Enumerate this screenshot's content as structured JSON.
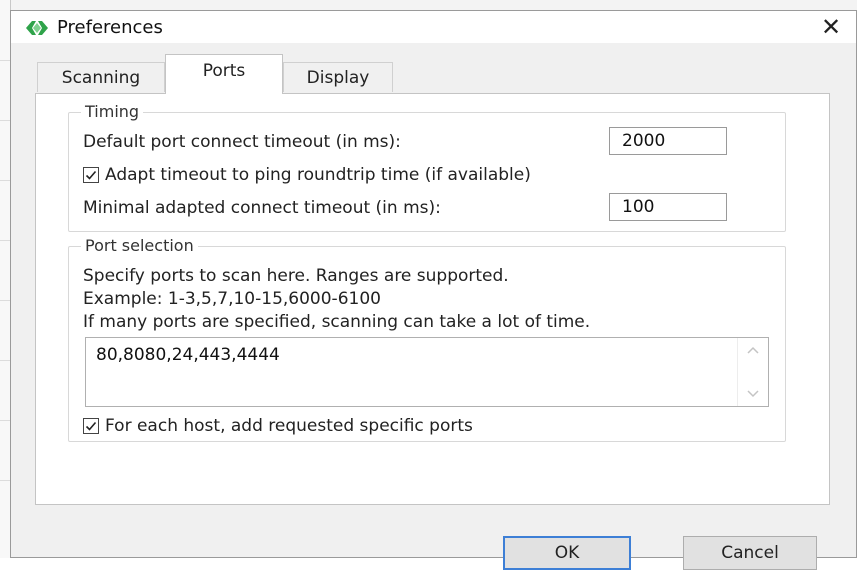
{
  "window": {
    "title": "Preferences",
    "close_symbol": "✕"
  },
  "tabs": [
    {
      "label": "Scanning",
      "active": false
    },
    {
      "label": "Ports",
      "active": true
    },
    {
      "label": "Display",
      "active": false
    }
  ],
  "timing": {
    "legend": "Timing",
    "default_timeout_label": "Default port connect timeout (in ms):",
    "default_timeout_value": "2000",
    "adapt_checkbox_label": "Adapt timeout to ping roundtrip time (if available)",
    "adapt_checked": true,
    "minimal_timeout_label": "Minimal adapted connect timeout (in ms):",
    "minimal_timeout_value": "100"
  },
  "port_selection": {
    "legend": "Port selection",
    "help_line1": "Specify ports to scan here. Ranges are supported.",
    "help_line2": "Example: 1-3,5,7,10-15,6000-6100",
    "help_line3": "If many ports are specified, scanning can take a lot of time.",
    "ports_value": "80,8080,24,443,4444",
    "specific_ports_label": "For each host, add requested specific ports",
    "specific_ports_checked": true
  },
  "buttons": {
    "ok_label": "OK",
    "cancel_label": "Cancel"
  },
  "colors": {
    "accent": "#3d7fd6",
    "dialog_bg": "#f0f0f0",
    "panel_bg": "#ffffff",
    "icon_green": "#2fa34a"
  },
  "icons": {
    "app": "app-icon",
    "close": "close-icon",
    "check": "checkmark-icon"
  }
}
